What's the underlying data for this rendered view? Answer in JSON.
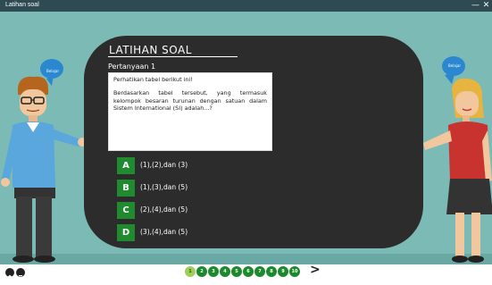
{
  "window": {
    "title": "Latihan soal",
    "min_glyph": "—",
    "close_glyph": "✕"
  },
  "board": {
    "title": "LATIHAN SOAL",
    "question_label": "Pertanyaan 1",
    "question_line1": "Perhatikan tabel berikut ini!",
    "question_text": "Berdasarkan tabel tersebut, yang termasuk kelompok besaran turunan dengan satuan dalam Sistem International (SI) adalah...?"
  },
  "options": [
    {
      "key": "A",
      "text": "(1),(2),dan (3)"
    },
    {
      "key": "B",
      "text": "(1),(3),dan (5)"
    },
    {
      "key": "C",
      "text": "(2),(4),dan (5)"
    },
    {
      "key": "D",
      "text": "(3),(4),dan (5)"
    }
  ],
  "characters": {
    "left_bubble": "Belajar",
    "right_bubble": "Belajar"
  },
  "pagination": {
    "pages": [
      "1",
      "2",
      "3",
      "4",
      "5",
      "6",
      "7",
      "8",
      "9",
      "10"
    ],
    "current": "1",
    "next_glyph": ">"
  },
  "colors": {
    "background": "#7bbab5",
    "board": "#2c2c2c",
    "option_key": "#1f8a2e",
    "page_dot": "#1c8a2c",
    "page_active": "#9fcf5a",
    "titlebar": "#2e4a52"
  },
  "icons": [
    "home-icon",
    "menu-icon",
    "chevron-right-icon",
    "minimize-icon",
    "close-icon"
  ]
}
